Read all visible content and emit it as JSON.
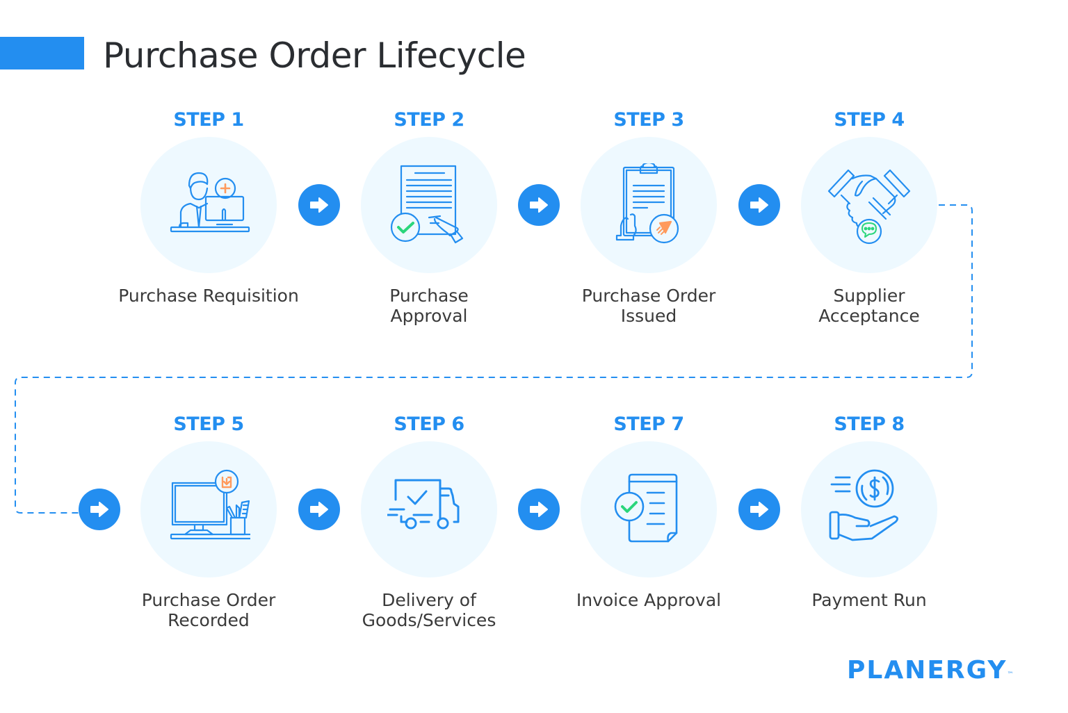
{
  "header": {
    "title": "Purchase Order Lifecycle"
  },
  "colors": {
    "accent": "#238ef0",
    "circle_bg": "#eef9ff",
    "text": "#3a3a3a",
    "title_text": "#2a2d31",
    "check_green": "#2bd67b",
    "highlight_orange": "#ff9a5c"
  },
  "steps": [
    {
      "label": "STEP 1",
      "caption_line1": "Purchase Requisition",
      "caption_line2": "",
      "icon": "person-at-computer-icon"
    },
    {
      "label": "STEP 2",
      "caption_line1": "Purchase",
      "caption_line2": "Approval",
      "icon": "signed-document-icon"
    },
    {
      "label": "STEP 3",
      "caption_line1": "Purchase Order",
      "caption_line2": "Issued",
      "icon": "clipboard-send-icon"
    },
    {
      "label": "STEP 4",
      "caption_line1": "Supplier",
      "caption_line2": "Acceptance",
      "icon": "handshake-icon"
    },
    {
      "label": "STEP 5",
      "caption_line1": "Purchase Order",
      "caption_line2": "Recorded",
      "icon": "desktop-record-icon"
    },
    {
      "label": "STEP 6",
      "caption_line1": "Delivery of",
      "caption_line2": "Goods/Services",
      "icon": "delivery-truck-icon"
    },
    {
      "label": "STEP 7",
      "caption_line1": "Invoice Approval",
      "caption_line2": "",
      "icon": "approved-invoice-icon"
    },
    {
      "label": "STEP 8",
      "caption_line1": "Payment Run",
      "caption_line2": "",
      "icon": "hand-coin-icon"
    }
  ],
  "arrows": [
    "arrow-right-icon",
    "arrow-right-icon",
    "arrow-right-icon",
    "arrow-right-icon",
    "arrow-right-icon",
    "arrow-right-icon",
    "arrow-right-icon"
  ],
  "branding": {
    "logo_text": "PLANERGY",
    "trademark": "™"
  }
}
